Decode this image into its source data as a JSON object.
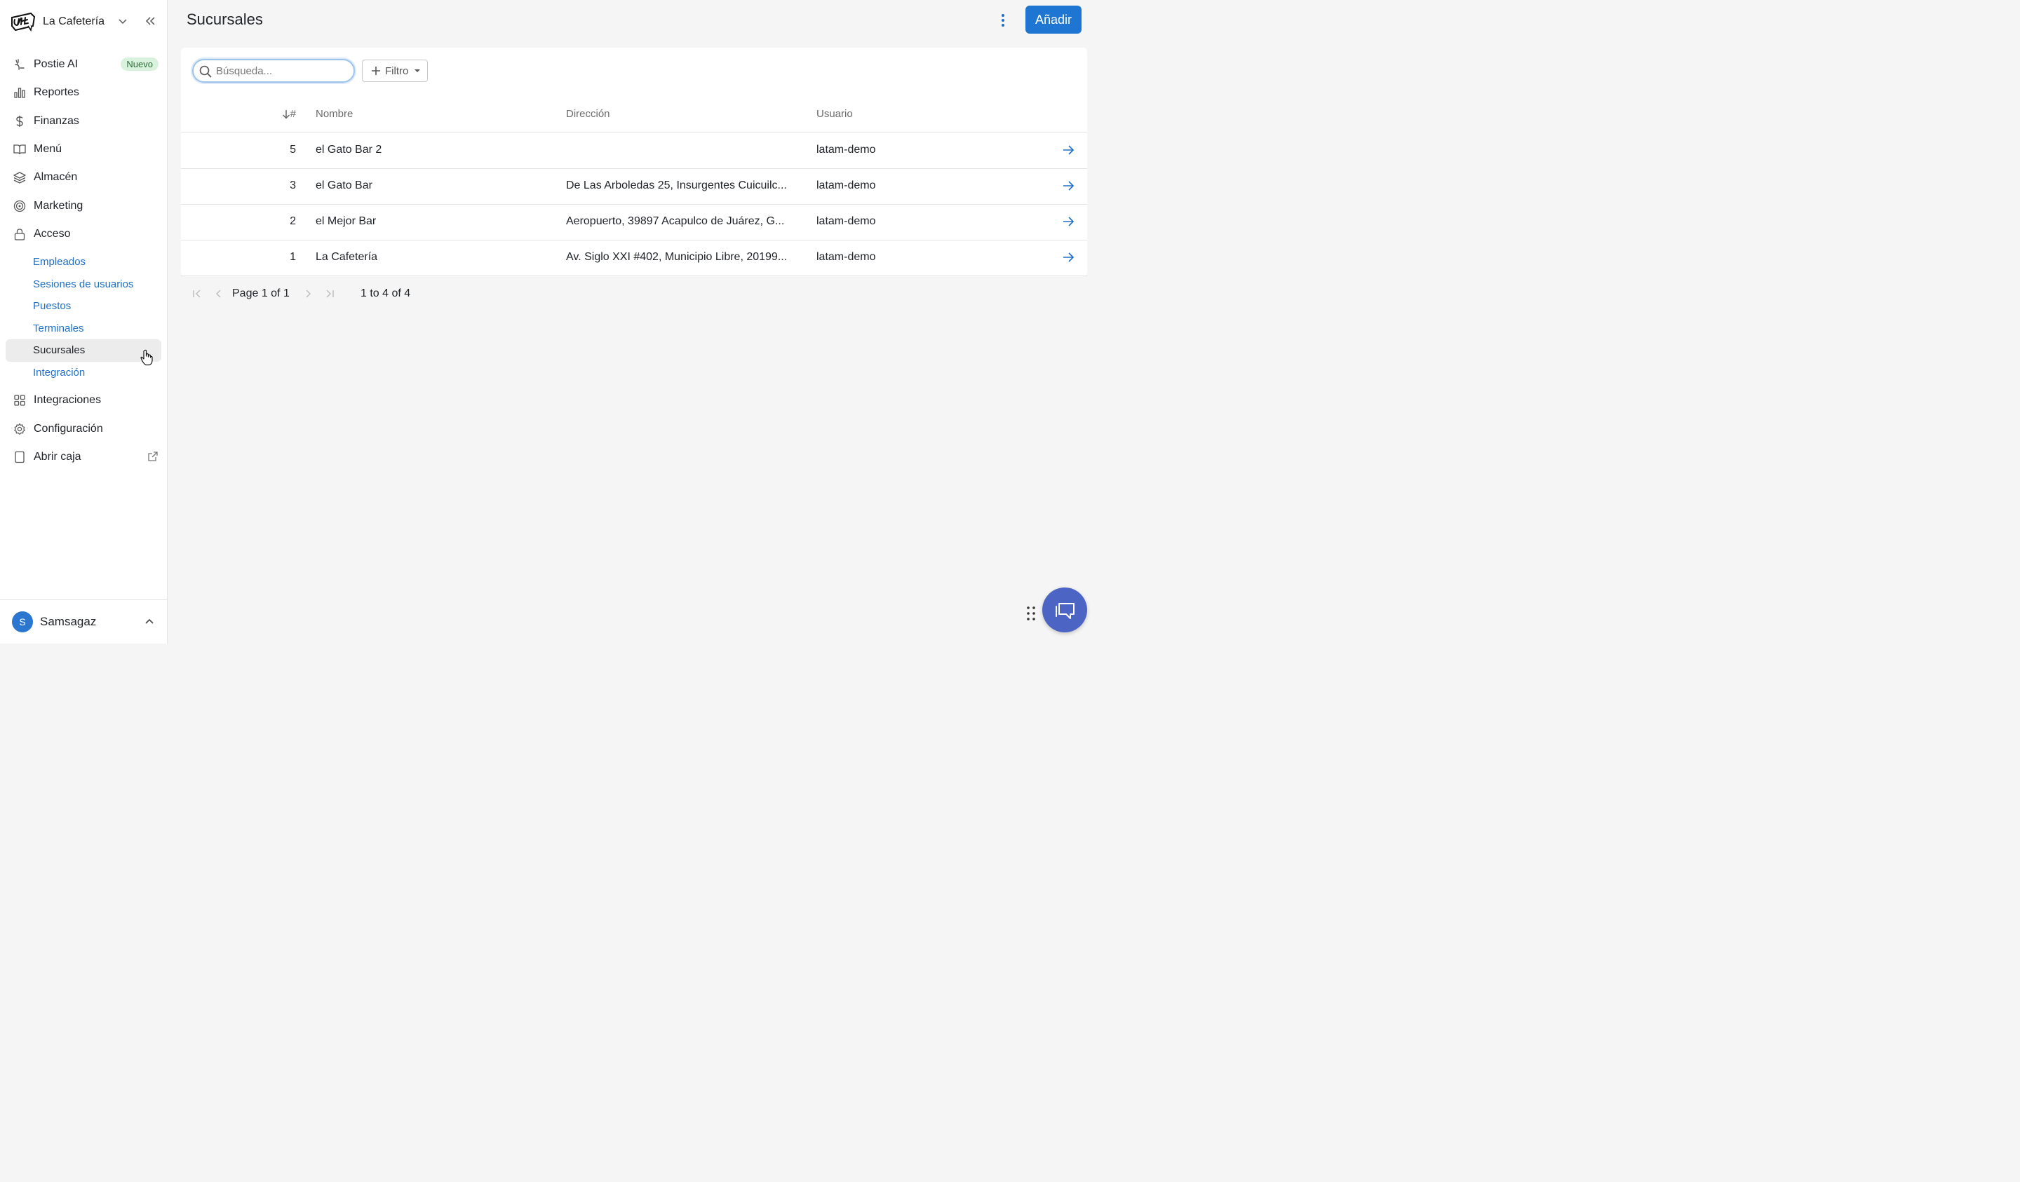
{
  "brand": {
    "name": "La Cafetería"
  },
  "nav": {
    "items": [
      {
        "label": "Postie AI",
        "badge": "Nuevo",
        "icon": "sparkle-icon"
      },
      {
        "label": "Reportes",
        "icon": "bar-chart-icon"
      },
      {
        "label": "Finanzas",
        "icon": "dollar-icon"
      },
      {
        "label": "Menú",
        "icon": "book-icon"
      },
      {
        "label": "Almacén",
        "icon": "layers-icon"
      },
      {
        "label": "Marketing",
        "icon": "target-icon"
      },
      {
        "label": "Acceso",
        "icon": "lock-icon"
      }
    ],
    "sub_items": [
      "Empleados",
      "Sesiones de usuarios",
      "Puestos",
      "Terminales",
      "Sucursales",
      "Integración"
    ],
    "active_sub": "Sucursales",
    "bottom_items": [
      {
        "label": "Integraciones",
        "icon": "grid-icon"
      },
      {
        "label": "Configuración",
        "icon": "gear-icon"
      },
      {
        "label": "Abrir caja",
        "icon": "tablet-icon"
      }
    ]
  },
  "user": {
    "initial": "S",
    "name": "Samsagaz"
  },
  "header": {
    "title": "Sucursales",
    "add_label": "Añadir"
  },
  "toolbar": {
    "search_placeholder": "Búsqueda...",
    "filter_label": "Filtro"
  },
  "table": {
    "columns": {
      "num": "#",
      "name": "Nombre",
      "address": "Dirección",
      "user": "Usuario"
    },
    "rows": [
      {
        "num": "5",
        "name": "el Gato Bar 2",
        "address": "",
        "user": "latam-demo"
      },
      {
        "num": "3",
        "name": "el Gato Bar",
        "address": "De Las Arboledas 25, Insurgentes Cuicuilc...",
        "user": "latam-demo"
      },
      {
        "num": "2",
        "name": "el Mejor Bar",
        "address": "Aeropuerto, 39897 Acapulco de Juárez, G...",
        "user": "latam-demo"
      },
      {
        "num": "1",
        "name": "La Cafetería",
        "address": "Av. Siglo XXI #402, Municipio Libre, 20199...",
        "user": "latam-demo"
      }
    ]
  },
  "pager": {
    "page_text": "Page 1 of 1",
    "range_text": "1 to 4 of 4"
  },
  "colors": {
    "accent": "#1f76d2",
    "link": "#1f6fc6",
    "chat": "#4c64c4"
  }
}
